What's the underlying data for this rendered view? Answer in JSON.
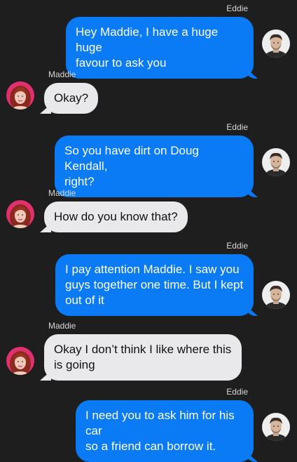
{
  "participants": {
    "eddie": {
      "name": "Eddie",
      "avatar_icon": "man-avatar-icon"
    },
    "maddie": {
      "name": "Maddie",
      "avatar_icon": "woman-avatar-icon"
    }
  },
  "colors": {
    "background": "#1e1e1e",
    "outgoing_bubble": "#0a7bf5",
    "incoming_bubble": "#e9e9eb"
  },
  "messages": [
    {
      "sender": "Eddie",
      "direction": "outgoing",
      "text_lines": [
        "Hey Maddie, I have a huge huge",
        "favour to ask you"
      ]
    },
    {
      "sender": "Maddie",
      "direction": "incoming",
      "text_lines": [
        "Okay?"
      ]
    },
    {
      "sender": "Eddie",
      "direction": "outgoing",
      "text_lines": [
        "So you have dirt on Doug Kendall,",
        "right?"
      ]
    },
    {
      "sender": "Maddie",
      "direction": "incoming",
      "text_lines": [
        "How do you know that?"
      ]
    },
    {
      "sender": "Eddie",
      "direction": "outgoing",
      "text_lines": [
        "I pay attention Maddie. I saw you",
        "guys together one time. But I kept",
        "out of it"
      ]
    },
    {
      "sender": "Maddie",
      "direction": "incoming",
      "text_lines": [
        "Okay I don’t think I like where this",
        "is going"
      ]
    },
    {
      "sender": "Eddie",
      "direction": "outgoing",
      "text_lines": [
        "I need you to ask him for his car",
        "so a friend can borrow it."
      ]
    }
  ]
}
